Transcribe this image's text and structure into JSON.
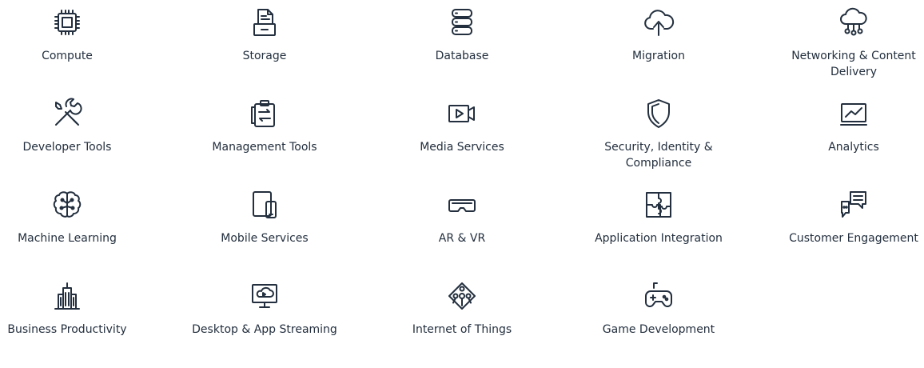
{
  "services": [
    {
      "label": "Compute",
      "icon": "compute-chip-icon"
    },
    {
      "label": "Storage",
      "icon": "storage-icon"
    },
    {
      "label": "Database",
      "icon": "database-icon"
    },
    {
      "label": "Migration",
      "icon": "migration-cloud-icon"
    },
    {
      "label": "Networking & Content Delivery",
      "icon": "networking-cloud-icon"
    },
    {
      "label": "Developer Tools",
      "icon": "developer-tools-icon"
    },
    {
      "label": "Management Tools",
      "icon": "management-tools-icon"
    },
    {
      "label": "Media Services",
      "icon": "media-services-icon"
    },
    {
      "label": "Security, Identity & Compliance",
      "icon": "shield-icon"
    },
    {
      "label": "Analytics",
      "icon": "analytics-icon"
    },
    {
      "label": "Machine Learning",
      "icon": "brain-icon"
    },
    {
      "label": "Mobile Services",
      "icon": "mobile-devices-icon"
    },
    {
      "label": "AR & VR",
      "icon": "vr-headset-icon"
    },
    {
      "label": "Application Integration",
      "icon": "puzzle-icon"
    },
    {
      "label": "Customer Engagement",
      "icon": "chat-bubbles-icon"
    },
    {
      "label": "Business Productivity",
      "icon": "buildings-icon"
    },
    {
      "label": "Desktop & App Streaming",
      "icon": "desktop-streaming-icon"
    },
    {
      "label": "Internet of Things",
      "icon": "iot-icon"
    },
    {
      "label": "Game Development",
      "icon": "gamepad-icon"
    }
  ]
}
